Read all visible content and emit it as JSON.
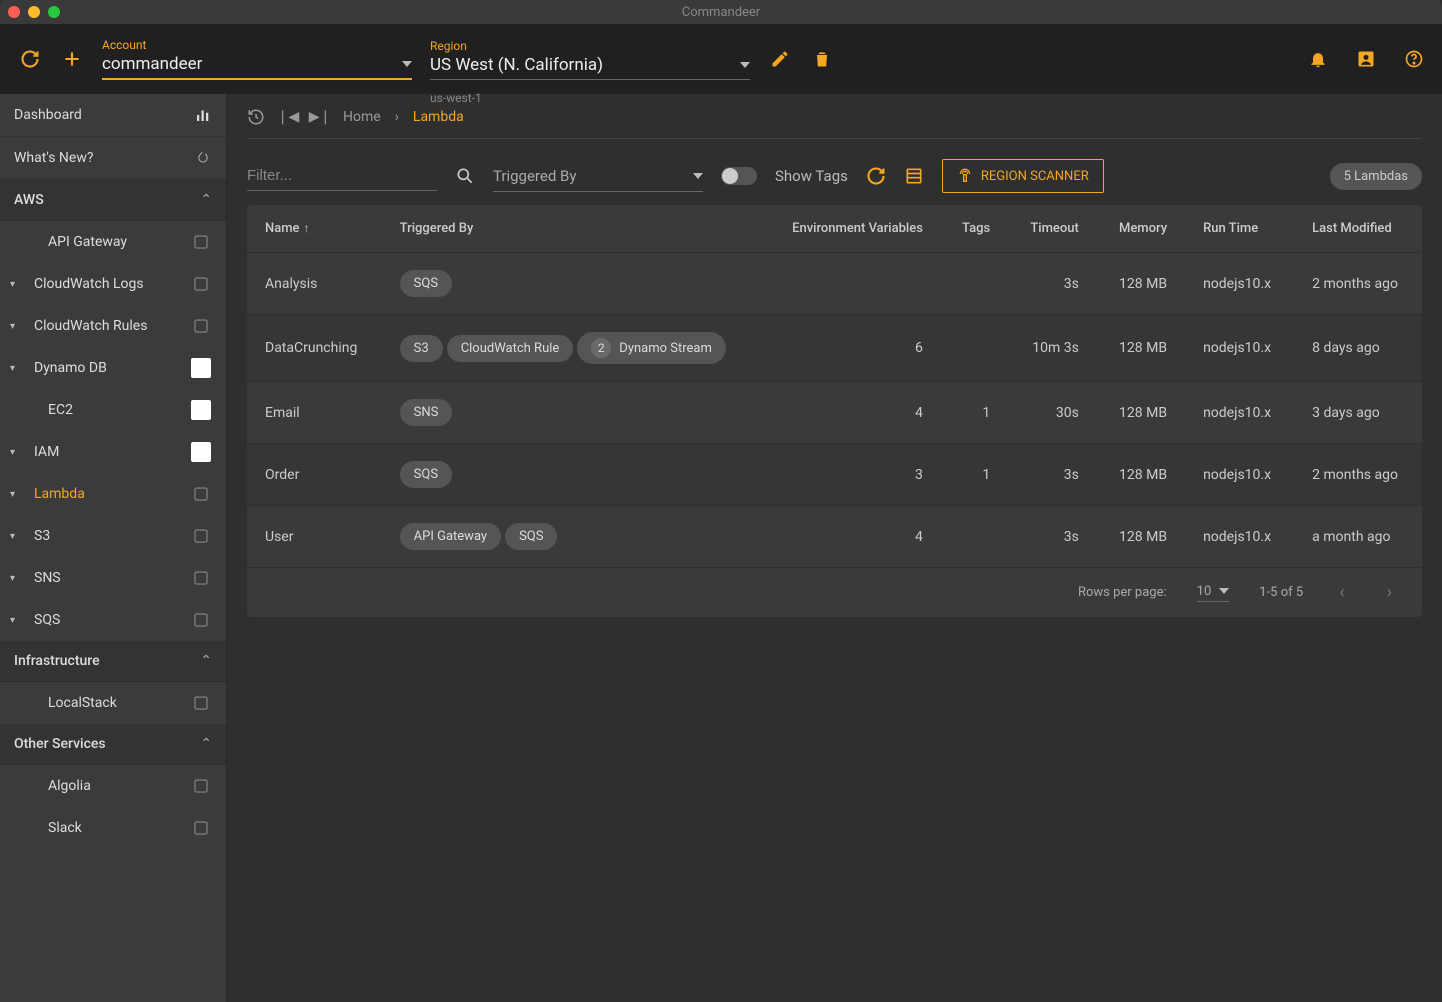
{
  "window": {
    "title": "Commandeer"
  },
  "topbar": {
    "account_label": "Account",
    "account_value": "commandeer",
    "region_label": "Region",
    "region_value": "US West (N. California)",
    "region_code": "us-west-1"
  },
  "sidebar": {
    "dashboard": "Dashboard",
    "whatsnew": "What's New?",
    "sections": [
      {
        "label": "AWS",
        "items": [
          {
            "label": "API Gateway",
            "expandable": false
          },
          {
            "label": "CloudWatch Logs",
            "expandable": true
          },
          {
            "label": "CloudWatch Rules",
            "expandable": true
          },
          {
            "label": "Dynamo DB",
            "expandable": true,
            "boxed": true
          },
          {
            "label": "EC2",
            "expandable": false,
            "boxed": true
          },
          {
            "label": "IAM",
            "expandable": true,
            "boxed": true
          },
          {
            "label": "Lambda",
            "expandable": true,
            "active": true
          },
          {
            "label": "S3",
            "expandable": true
          },
          {
            "label": "SNS",
            "expandable": true
          },
          {
            "label": "SQS",
            "expandable": true
          }
        ]
      },
      {
        "label": "Infrastructure",
        "items": [
          {
            "label": "LocalStack",
            "expandable": false
          }
        ]
      },
      {
        "label": "Other Services",
        "items": [
          {
            "label": "Algolia",
            "expandable": false
          },
          {
            "label": "Slack",
            "expandable": false
          }
        ]
      }
    ]
  },
  "breadcrumb": {
    "home": "Home",
    "current": "Lambda"
  },
  "toolbar": {
    "filter_placeholder": "Filter...",
    "triggered_by_label": "Triggered By",
    "show_tags": "Show Tags",
    "scanner": "REGION SCANNER",
    "count": "5 Lambdas"
  },
  "table": {
    "columns": [
      "Name",
      "Triggered By",
      "Environment Variables",
      "Tags",
      "Timeout",
      "Memory",
      "Run Time",
      "Last Modified"
    ],
    "sort_indicator": "↑",
    "rows": [
      {
        "name": "Analysis",
        "triggers": [
          {
            "label": "SQS"
          }
        ],
        "env": "",
        "tags": "",
        "timeout": "3s",
        "memory": "128 MB",
        "runtime": "nodejs10.x",
        "modified": "2 months ago"
      },
      {
        "name": "DataCrunching",
        "triggers": [
          {
            "label": "S3"
          },
          {
            "label": "CloudWatch Rule"
          },
          {
            "label": "Dynamo Stream",
            "count": "2"
          }
        ],
        "env": "6",
        "tags": "",
        "timeout": "10m 3s",
        "memory": "128 MB",
        "runtime": "nodejs10.x",
        "modified": "8 days ago"
      },
      {
        "name": "Email",
        "triggers": [
          {
            "label": "SNS"
          }
        ],
        "env": "4",
        "tags": "1",
        "timeout": "30s",
        "memory": "128 MB",
        "runtime": "nodejs10.x",
        "modified": "3 days ago"
      },
      {
        "name": "Order",
        "triggers": [
          {
            "label": "SQS"
          }
        ],
        "env": "3",
        "tags": "1",
        "timeout": "3s",
        "memory": "128 MB",
        "runtime": "nodejs10.x",
        "modified": "2 months ago"
      },
      {
        "name": "User",
        "triggers": [
          {
            "label": "API Gateway"
          },
          {
            "label": "SQS"
          }
        ],
        "env": "4",
        "tags": "",
        "timeout": "3s",
        "memory": "128 MB",
        "runtime": "nodejs10.x",
        "modified": "a month ago"
      }
    ],
    "footer": {
      "rows_per_page_label": "Rows per page:",
      "rows_per_page_value": "10",
      "range": "1-5 of 5"
    }
  }
}
